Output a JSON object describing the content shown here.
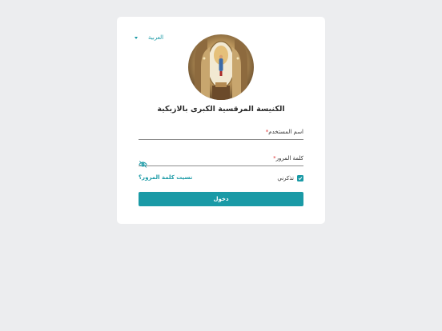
{
  "app": {
    "language_selector": "العربية",
    "title": "الكنيسة المرقسية الكبرى بالازبكية"
  },
  "form": {
    "username_label": "اسم المستخدم",
    "password_label": "كلمة المرور",
    "required_mark": "*",
    "username_value": "",
    "password_value": "",
    "remember_label": "تذكرني",
    "remember_checked": true,
    "forgot_link": "نسيت كلمة المرور؟",
    "submit_label": "دخول"
  },
  "icons": {
    "language_caret": "chevron-down-icon",
    "password_toggle": "eye-off-icon",
    "checkbox": "check-icon"
  },
  "colors": {
    "accent": "#1a9aa6",
    "background": "#ecedef",
    "card": "#ffffff",
    "required": "#dd3333"
  }
}
